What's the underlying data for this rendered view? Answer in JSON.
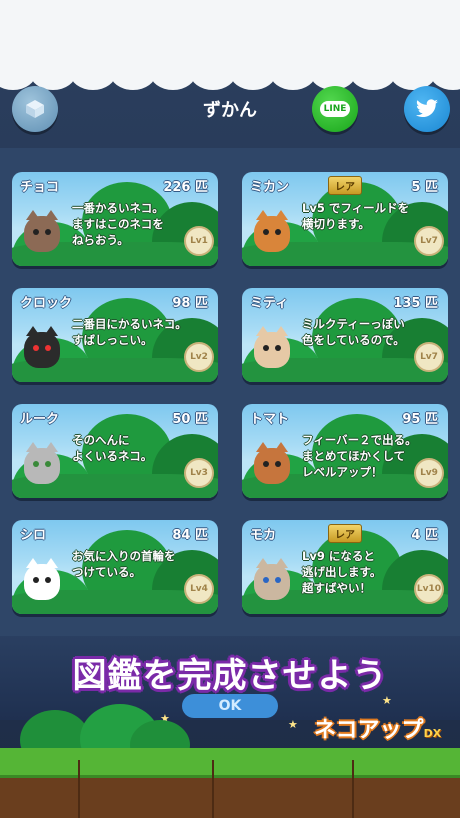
{
  "header": {
    "title": "ずかん",
    "line_label": "LINE",
    "twitter_icon": "twitter-bird-icon",
    "box_icon": "cube-icon"
  },
  "cards": [
    {
      "name": "チョコ",
      "count": "226 匹",
      "rare": "",
      "desc": "一番かるいネコ。\nますはこのネコを\nねらおう。",
      "level": "Lv1",
      "cat_color": "#8c6a55"
    },
    {
      "name": "ミカン",
      "count": "5 匹",
      "rare": "レア",
      "desc": "Lv5 でフィールドを\n横切ります。",
      "level": "Lv7",
      "cat_color": "#d9853a"
    },
    {
      "name": "クロック",
      "count": "98 匹",
      "rare": "",
      "desc": "二番目にかるいネコ。\nすばしっこい。",
      "level": "Lv2",
      "cat_color": "#2b2b2b"
    },
    {
      "name": "ミティ",
      "count": "135 匹",
      "rare": "",
      "desc": "ミルクティーっぽい\n色をしているので。",
      "level": "Lv7",
      "cat_color": "#e6c9a6"
    },
    {
      "name": "ルーク",
      "count": "50 匹",
      "rare": "",
      "desc": "そのへんに\nよくいるネコ。",
      "level": "Lv3",
      "cat_color": "#b8b8b8"
    },
    {
      "name": "トマト",
      "count": "95 匹",
      "rare": "",
      "desc": "フィーバー２で出る。\nまとめてほかくして\nレベルアップ！",
      "level": "Lv9",
      "cat_color": "#c6753d"
    },
    {
      "name": "シロ",
      "count": "84 匹",
      "rare": "",
      "desc": "お気に入りの首輪を\nつけている。",
      "level": "Lv4",
      "cat_color": "#ffffff"
    },
    {
      "name": "モカ",
      "count": "4 匹",
      "rare": "レア",
      "desc": "Lv9 になると\n逃げ出します。\n超すばやい！",
      "level": "Lv10",
      "cat_color": "#cbb7a0"
    }
  ],
  "banner": {
    "text": "図鑑を完成させよう",
    "ok_label": "OK",
    "logo": "ネコアップ",
    "logo_suffix": "DX"
  }
}
